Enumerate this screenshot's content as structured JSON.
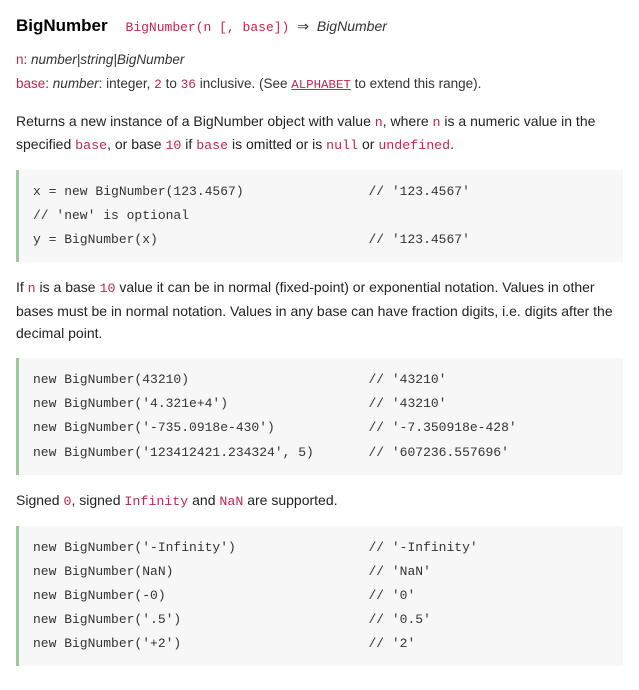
{
  "header": {
    "name": "BigNumber",
    "signature": "BigNumber(n [, base])",
    "arrow": "⇒",
    "returnType": "BigNumber"
  },
  "params": {
    "n": {
      "name": "n",
      "type": "number|string|BigNumber"
    },
    "base": {
      "name": "base",
      "type": "number",
      "desc1": ": integer, ",
      "range1": "2",
      "desc2": " to ",
      "range2": "36",
      "desc3": " inclusive. (See ",
      "link": "ALPHABET",
      "desc4": " to extend this range)."
    }
  },
  "para1": {
    "t1": "Returns a new instance of a BigNumber object with value ",
    "c1": "n",
    "t2": ", where ",
    "c2": "n",
    "t3": " is a numeric value in the specified ",
    "c3": "base",
    "t4": ", or base ",
    "c4": "10",
    "t5": " if ",
    "c5": "base",
    "t6": " is omitted or is ",
    "c6": "null",
    "t7": " or ",
    "c7": "undefined",
    "t8": "."
  },
  "code1": "x = new BigNumber(123.4567)                // '123.4567'\n// 'new' is optional\ny = BigNumber(x)                           // '123.4567'",
  "para2": {
    "t1": "If ",
    "c1": "n",
    "t2": " is a base ",
    "c2": "10",
    "t3": " value it can be in normal (fixed-point) or exponential notation. Values in other bases must be in normal notation. Values in any base can have fraction digits, i.e. digits after the decimal point."
  },
  "code2": "new BigNumber(43210)                       // '43210'\nnew BigNumber('4.321e+4')                  // '43210'\nnew BigNumber('-735.0918e-430')            // '-7.350918e-428'\nnew BigNumber('123412421.234324', 5)       // '607236.557696'",
  "para3": {
    "t1": "Signed ",
    "c1": "0",
    "t2": ", signed ",
    "c2": "Infinity",
    "t3": " and ",
    "c3": "NaN",
    "t4": " are supported."
  },
  "code3": "new BigNumber('-Infinity')                 // '-Infinity'\nnew BigNumber(NaN)                         // 'NaN'\nnew BigNumber(-0)                          // '0'\nnew BigNumber('.5')                        // '0.5'\nnew BigNumber('+2')                        // '2'"
}
